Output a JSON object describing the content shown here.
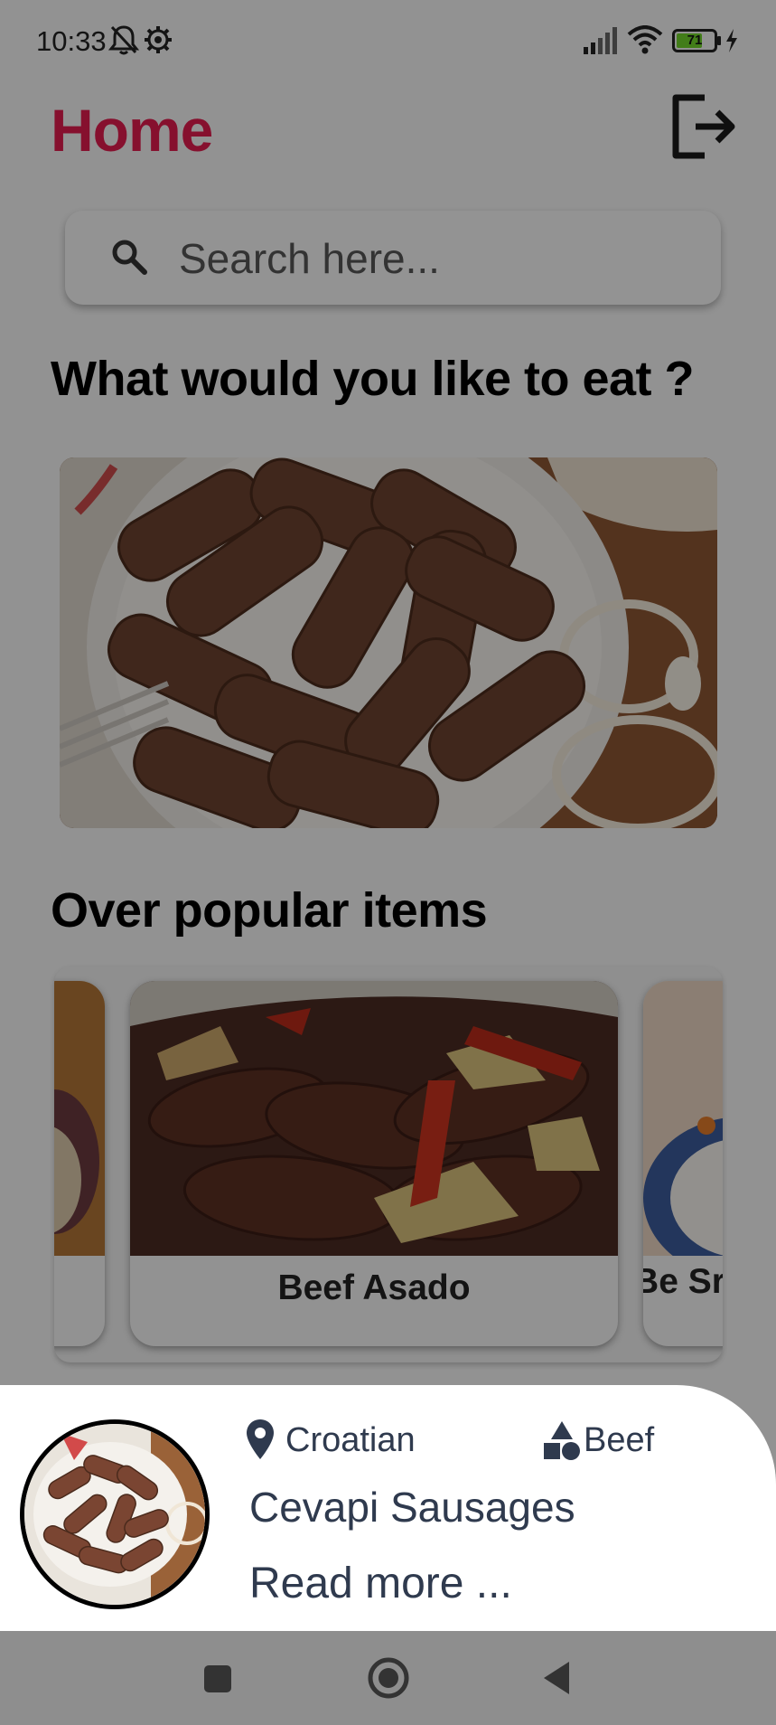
{
  "status_bar": {
    "time": "10:33",
    "battery_percent": 71,
    "icons": [
      "mute-icon",
      "settings-icon",
      "signal-icon",
      "wifi-icon",
      "battery-icon",
      "charging-icon"
    ]
  },
  "header": {
    "title": "Home",
    "title_color": "#e01c4e",
    "logout_icon": "logout-icon"
  },
  "search": {
    "placeholder": "Search here...",
    "value": ""
  },
  "sections": {
    "featured_title": "What would you like to eat ?",
    "popular_title": "Over popular items"
  },
  "popular_items": [
    {
      "label": ""
    },
    {
      "label": "Beef Asado"
    },
    {
      "label": "Be Sr"
    }
  ],
  "bottom_sheet": {
    "area": "Croatian",
    "category": "Beef",
    "meal_name": "Cevapi Sausages",
    "read_more": "Read more ...",
    "text_color": "#2f3a4e"
  },
  "nav_bar": {
    "buttons": [
      "recents-button",
      "home-button",
      "back-button"
    ]
  }
}
